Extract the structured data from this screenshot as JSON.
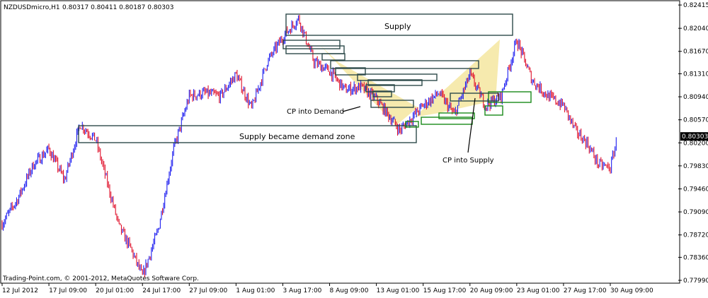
{
  "chart_data": {
    "type": "candlestick",
    "symbol_title": "NZDUSDmicro,H1",
    "ohlc_readout": "0.80317 0.80411 0.80187 0.80303",
    "current_price_label": "0.80303",
    "watermark": "Trading-Point.com, © 2001-2012, MetaQuotes Software Corp.",
    "y_ticks": [
      "0.82415",
      "0.82040",
      "0.81670",
      "0.81310",
      "0.80940",
      "0.80570",
      "0.80200",
      "0.79830",
      "0.79460",
      "0.79090",
      "0.78720",
      "0.78360",
      "0.77990"
    ],
    "ylim": [
      0.7799,
      0.8245
    ],
    "x_ticks": [
      "12 Jul 2012",
      "17 Jul 09:00",
      "20 Jul 01:00",
      "24 Jul 17:00",
      "27 Jul 09:00",
      "1 Aug 01:00",
      "3 Aug 17:00",
      "8 Aug 09:00",
      "13 Aug 01:00",
      "15 Aug 17:00",
      "20 Aug 09:00",
      "23 Aug 01:00",
      "27 Aug 17:00",
      "30 Aug 09:00"
    ],
    "price_path": [
      {
        "x": "12 Jul 2012",
        "y": 0.789
      },
      {
        "x": "13 Jul 2012",
        "y": 0.793
      },
      {
        "x": "16 Jul 2012",
        "y": 0.7985
      },
      {
        "x": "17 Jul 09:00",
        "y": 0.801
      },
      {
        "x": "18 Jul 2012",
        "y": 0.796
      },
      {
        "x": "19 Jul 2012",
        "y": 0.805
      },
      {
        "x": "20 Jul 01:00",
        "y": 0.8025
      },
      {
        "x": "21 Jul 2012",
        "y": 0.7955
      },
      {
        "x": "23 Jul 2012",
        "y": 0.7885
      },
      {
        "x": "24 Jul 2012",
        "y": 0.785
      },
      {
        "x": "24 Jul 17:00",
        "y": 0.7805
      },
      {
        "x": "25 Jul 2012",
        "y": 0.788
      },
      {
        "x": "26 Jul 2012",
        "y": 0.801
      },
      {
        "x": "27 Jul 09:00",
        "y": 0.8095
      },
      {
        "x": "30 Jul 2012",
        "y": 0.81
      },
      {
        "x": "31 Jul 2012",
        "y": 0.8095
      },
      {
        "x": "1 Aug 01:00",
        "y": 0.813
      },
      {
        "x": "2 Aug 2012",
        "y": 0.8075
      },
      {
        "x": "3 Aug 2012",
        "y": 0.815
      },
      {
        "x": "3 Aug 17:00",
        "y": 0.819
      },
      {
        "x": "6 Aug 2012",
        "y": 0.822
      },
      {
        "x": "7 Aug 2012",
        "y": 0.815
      },
      {
        "x": "8 Aug 09:00",
        "y": 0.8135
      },
      {
        "x": "9 Aug 2012",
        "y": 0.8105
      },
      {
        "x": "10 Aug 2012",
        "y": 0.811
      },
      {
        "x": "13 Aug 01:00",
        "y": 0.809
      },
      {
        "x": "14 Aug 2012",
        "y": 0.804
      },
      {
        "x": "15 Aug 17:00",
        "y": 0.808
      },
      {
        "x": "16 Aug 2012",
        "y": 0.81
      },
      {
        "x": "17 Aug 2012",
        "y": 0.8065
      },
      {
        "x": "20 Aug 09:00",
        "y": 0.813
      },
      {
        "x": "21 Aug 2012",
        "y": 0.808
      },
      {
        "x": "22 Aug 2012",
        "y": 0.8095
      },
      {
        "x": "23 Aug 01:00",
        "y": 0.8185
      },
      {
        "x": "24 Aug 2012",
        "y": 0.812
      },
      {
        "x": "27 Aug 2012",
        "y": 0.8095
      },
      {
        "x": "27 Aug 17:00",
        "y": 0.808
      },
      {
        "x": "28 Aug 2012",
        "y": 0.804
      },
      {
        "x": "29 Aug 2012",
        "y": 0.802
      },
      {
        "x": "30 Aug 2012",
        "y": 0.7985
      },
      {
        "x": "30 Aug 09:00",
        "y": 0.798
      },
      {
        "x": "31 Aug 2012",
        "y": 0.803
      }
    ],
    "annotations": {
      "supply_label": "Supply",
      "demand_zone_label": "Supply became demand zone",
      "cp_demand_label": "CP into Demand",
      "cp_supply_label": "CP into Supply"
    },
    "colors": {
      "background": "#ffffff",
      "up_candle": "#1e1ef0",
      "down_candle": "#e0102a",
      "zone_border": "#2d4a4a",
      "demand_zone_border": "#1a8a1a",
      "triangle_fill": "#f5e6a0",
      "price_label_bg": "#000000",
      "price_label_text": "#ffffff"
    }
  }
}
